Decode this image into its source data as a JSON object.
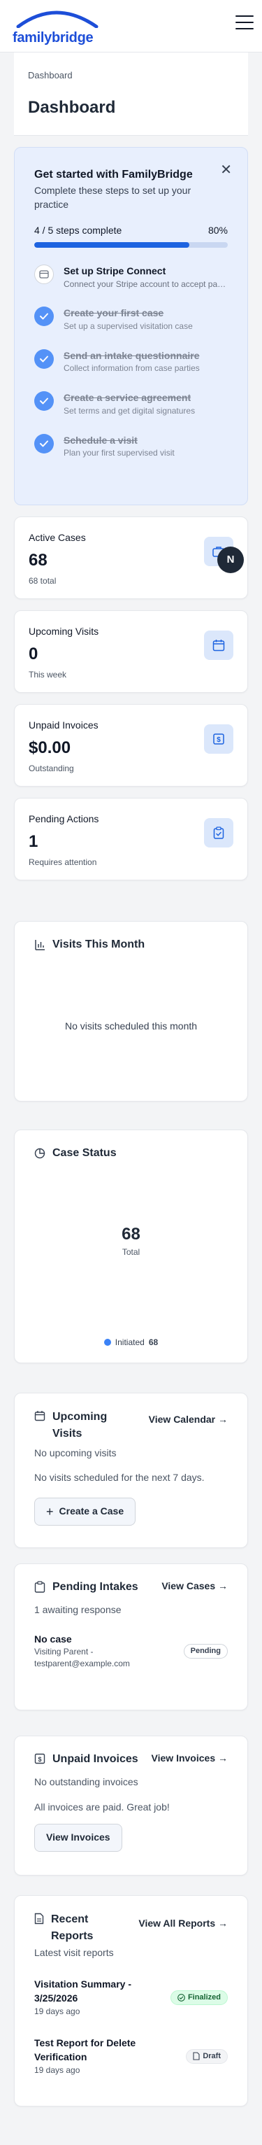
{
  "app": {
    "logo_text": "familybridge",
    "avatar_initial": "N"
  },
  "header": {
    "breadcrumb": "Dashboard",
    "title": "Dashboard"
  },
  "onboarding": {
    "title": "Get started with FamilyBridge",
    "subtitle": "Complete these steps to set up your practice",
    "progress_label": "4 / 5 steps complete",
    "progress_percent_label": "80%",
    "progress_fraction": 0.8,
    "steps": [
      {
        "title": "Set up Stripe Connect",
        "description": "Connect your Stripe account to accept payments",
        "done": false,
        "icon": "stripe-card-icon"
      },
      {
        "title": "Create your first case",
        "description": "Set up a supervised visitation case",
        "done": true,
        "icon": "check-icon"
      },
      {
        "title": "Send an intake questionnaire",
        "description": "Collect information from case parties",
        "done": true,
        "icon": "check-icon"
      },
      {
        "title": "Create a service agreement",
        "description": "Set terms and get digital signatures",
        "done": true,
        "icon": "check-icon"
      },
      {
        "title": "Schedule a visit",
        "description": "Plan your first supervised visit",
        "done": true,
        "icon": "check-icon"
      }
    ]
  },
  "stats": [
    {
      "label": "Active Cases",
      "value": "68",
      "sub": "68 total",
      "icon": "briefcase-icon"
    },
    {
      "label": "Upcoming Visits",
      "value": "0",
      "sub": "This week",
      "icon": "calendar-icon"
    },
    {
      "label": "Unpaid Invoices",
      "value": "$0.00",
      "sub": "Outstanding",
      "icon": "dollar-icon"
    },
    {
      "label": "Pending Actions",
      "value": "1",
      "sub": "Requires attention",
      "icon": "clipboard-check-icon"
    }
  ],
  "visits_chart": {
    "title": "Visits This Month",
    "empty_text": "No visits scheduled this month"
  },
  "case_status": {
    "title": "Case Status",
    "total_value": "68",
    "total_label": "Total",
    "chart_data": {
      "type": "pie",
      "categories": [
        "Initiated"
      ],
      "values": [
        68
      ]
    },
    "legend": [
      {
        "label": "Initiated",
        "value": "68",
        "color": "#3b82f6"
      }
    ]
  },
  "upcoming_visits": {
    "title": "Upcoming Visits",
    "link": "View Calendar →",
    "status": "No upcoming visits",
    "empty_text": "No visits scheduled for the next 7 days.",
    "button": "Create a Case"
  },
  "pending_intakes": {
    "title": "Pending Intakes",
    "link": "View Cases →",
    "status": "1 awaiting response",
    "items": [
      {
        "title": "No case",
        "line1": "Visiting Parent -",
        "line2": "testparent@example.com",
        "badge": "Pending"
      }
    ]
  },
  "unpaid_invoices": {
    "title": "Unpaid Invoices",
    "link": "View Invoices →",
    "status": "No outstanding invoices",
    "empty_text": "All invoices are paid. Great job!",
    "button": "View Invoices"
  },
  "recent_reports": {
    "title": "Recent Reports",
    "link": "View All Reports →",
    "status": "Latest visit reports",
    "items": [
      {
        "title": "Visitation Summary - 3/25/2026",
        "date": "19 days ago",
        "badge": "Finalized"
      },
      {
        "title": "Test Report for Delete Verification",
        "date": "19 days ago",
        "badge": "Draft"
      }
    ]
  },
  "colors": {
    "accent": "#1d63e0",
    "brand": "#1d4ed8",
    "onboarding_bg": "#e8effd",
    "icon_bg": "#dbe7fb"
  }
}
